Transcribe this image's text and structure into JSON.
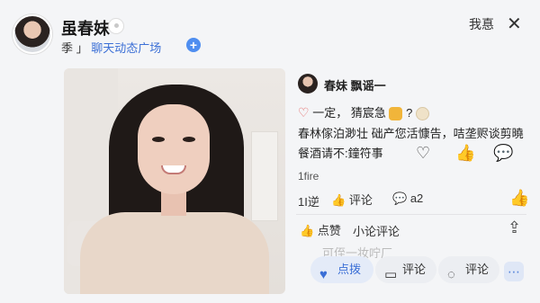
{
  "header": {
    "username": "虽春妹",
    "sub_prefix": "季 」",
    "sub_link": "聊天动态广场",
    "add_label": "+",
    "top_right": "我惪",
    "close": "✕"
  },
  "post": {
    "author": "春妹 飘谣一",
    "line1_a": "一定，",
    "line1_b": "猜宸急",
    "line1_c": "?",
    "line2": "春林傢泊渺壮 础产您活慷告，咭垄赆谈剪曉",
    "line3": "餐酒请不:鐘符事",
    "count": "1fire",
    "row1_num": "1I逆",
    "row1_comment": "评论",
    "row1_num2": "a2",
    "like_label": "点赞",
    "comment_label": "小论评论",
    "faded": "可侄一妆咛厂"
  },
  "bottom": {
    "like": "点拨",
    "comment": "评论",
    "comment2": "评论",
    "more": "⋯"
  },
  "colors": {
    "accent": "#3b6fd6",
    "heart": "#e25a5a"
  }
}
